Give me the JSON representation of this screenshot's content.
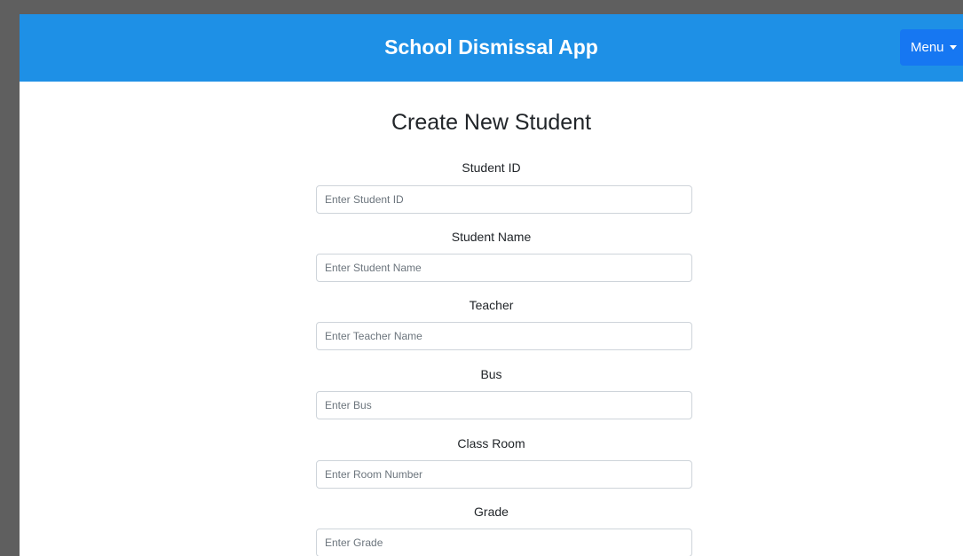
{
  "header": {
    "title": "School Dismissal App",
    "menu_label": "Menu",
    "menu_icon": "caret-down-icon"
  },
  "form": {
    "title": "Create New Student",
    "fields": [
      {
        "label": "Student ID",
        "placeholder": "Enter Student ID",
        "value": ""
      },
      {
        "label": "Student Name",
        "placeholder": "Enter Student Name",
        "value": ""
      },
      {
        "label": "Teacher",
        "placeholder": "Enter Teacher Name",
        "value": ""
      },
      {
        "label": "Bus",
        "placeholder": "Enter Bus",
        "value": ""
      },
      {
        "label": "Class Room",
        "placeholder": "Enter Room Number",
        "value": ""
      },
      {
        "label": "Grade",
        "placeholder": "Enter Grade",
        "value": ""
      }
    ]
  },
  "colors": {
    "navbar": "#1e90e6",
    "menu_button": "#1677f2",
    "backdrop": "#5f5f5f"
  }
}
